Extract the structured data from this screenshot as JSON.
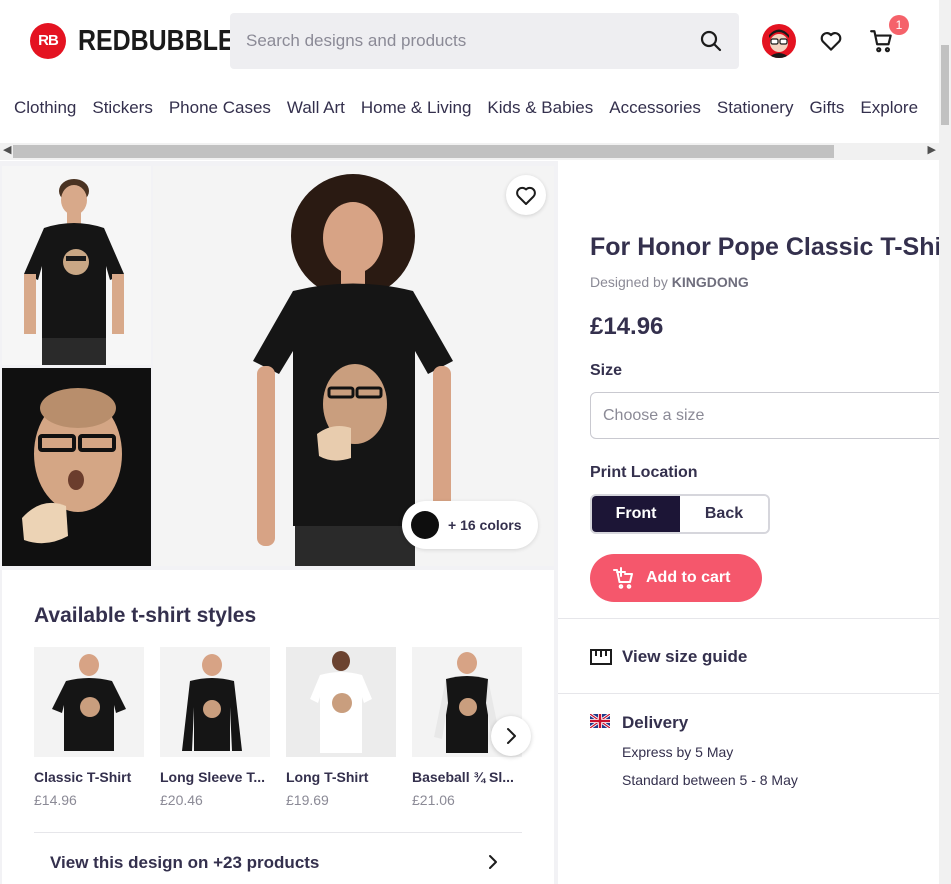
{
  "header": {
    "logo_text": "REDBUBBLE",
    "logo_mark": "RB",
    "search_placeholder": "Search designs and products",
    "cart_count": "1",
    "brand_color": "#e41321"
  },
  "nav": {
    "items": [
      "Clothing",
      "Stickers",
      "Phone Cases",
      "Wall Art",
      "Home & Living",
      "Kids & Babies",
      "Accessories",
      "Stationery",
      "Gifts",
      "Explore"
    ]
  },
  "gallery": {
    "colors_label": "+ 16 colors",
    "selected_color": "#0e0e0e"
  },
  "styles": {
    "title": "Available t-shirt styles",
    "items": [
      {
        "name": "Classic T-Shirt",
        "price": "£14.96"
      },
      {
        "name": "Long Sleeve T...",
        "price": "£20.46"
      },
      {
        "name": "Long T-Shirt",
        "price": "£19.69"
      },
      {
        "name": "Baseball ¾ Sl...",
        "price": "£21.06"
      }
    ],
    "view_design": "View this design on +23 products"
  },
  "product": {
    "title": "For Honor Pope Classic T-Shirt",
    "designed_by_prefix": "Designed by",
    "designer": "KINGDONG",
    "price": "£14.96",
    "size_label": "Size",
    "size_placeholder": "Choose a size",
    "print_location_label": "Print Location",
    "print_front": "Front",
    "print_back": "Back",
    "add_to_cart": "Add to cart",
    "size_guide": "View size guide",
    "delivery_title": "Delivery",
    "delivery_express": "Express by 5 May",
    "delivery_standard": "Standard between 5 - 8 May",
    "accent_color": "#f5576c"
  }
}
